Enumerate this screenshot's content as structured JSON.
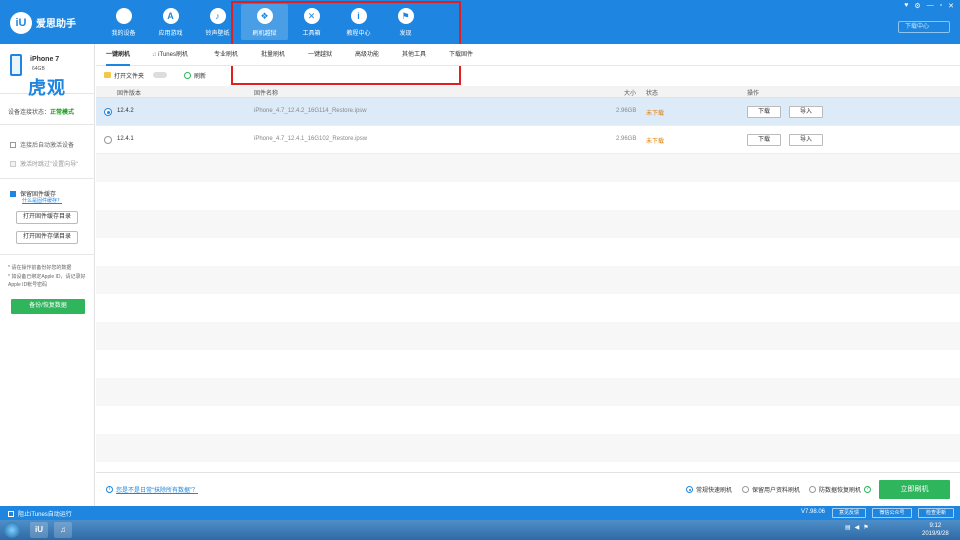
{
  "app": {
    "logo_mark": "iU",
    "logo_text": "爱思助手",
    "window_controls": [
      "♥",
      "⚙",
      "—",
      "▫",
      "✕"
    ],
    "download_center": "下载中心"
  },
  "main_nav": [
    {
      "label": "我的设备",
      "icon": "apple-icon",
      "glyph": ""
    },
    {
      "label": "应用游戏",
      "icon": "appstore-icon",
      "glyph": "A"
    },
    {
      "label": "铃声壁纸",
      "icon": "wallpaper-icon",
      "glyph": "♪"
    },
    {
      "label": "刷机越狱",
      "icon": "dropbox-icon",
      "glyph": "❖"
    },
    {
      "label": "工具箱",
      "icon": "toolbox-icon",
      "glyph": "✕"
    },
    {
      "label": "教程中心",
      "icon": "info-icon",
      "glyph": "i"
    },
    {
      "label": "发现",
      "icon": "flag-icon",
      "glyph": "⚑"
    }
  ],
  "device": {
    "name": "iPhone 7",
    "capacity": "64GB",
    "watermark": "虎观",
    "status_label": "设备连接状态：",
    "status_value": "正常模式"
  },
  "left_options": {
    "auto_activate": "连接后自动激活设备",
    "skip_wizard": "激活时跳过\"设置向导\"",
    "keep_firmware": "保留固件缓存",
    "what_is_cache": "什么是固件缓存？",
    "open_cache_dir": "打开固件缓存目录",
    "open_storage_dir": "打开固件存储目录",
    "tip1": "* 请在操作前备份好您的数据",
    "tip2": "* 如设备已绑定Apple ID，请记录好Apple ID帐号密码",
    "backup_btn": "备份/恢复数据"
  },
  "subtabs": [
    "一键刷机",
    "iTunes刷机",
    "专业刷机",
    "批量刷机",
    "一键越狱",
    "高级功能",
    "其他工具",
    "下载固件"
  ],
  "toolbar": {
    "open_folder": "打开文件夹",
    "refresh": "刷新"
  },
  "table": {
    "headers": {
      "version": "固件版本",
      "name": "固件名称",
      "size": "大小",
      "status": "状态",
      "action": "操作"
    },
    "rows": [
      {
        "version": "12.4.2",
        "name": "iPhone_4.7_12.4.2_16G114_Restore.ipsw",
        "size": "2.96GB",
        "status": "未下载",
        "download": "下载",
        "import": "导入",
        "selected": true
      },
      {
        "version": "12.4.1",
        "name": "iPhone_4.7_12.4.1_16G102_Restore.ipsw",
        "size": "2.96GB",
        "status": "未下载",
        "download": "下载",
        "import": "导入",
        "selected": false
      }
    ]
  },
  "bottom": {
    "erase_link": "您是不是日常“抹除所有数据”？",
    "mode_normal": "常规快速刷机",
    "mode_keep": "保留用户资料刷机",
    "mode_antirecover": "防数据恢复刷机",
    "flash_btn": "立即刷机"
  },
  "statusbar": {
    "block_itunes": "阻止iTunes自动运行",
    "version": "V7.98.06",
    "feedback": "意见反馈",
    "wechat": "微信公众号",
    "check_update": "检查更新"
  },
  "taskbar": {
    "time": "9:12",
    "date": "2019/9/28"
  },
  "colors": {
    "accent": "#1e86e0",
    "success": "#2fb55c",
    "warning": "#e07b00",
    "highlight": "#e02020"
  }
}
